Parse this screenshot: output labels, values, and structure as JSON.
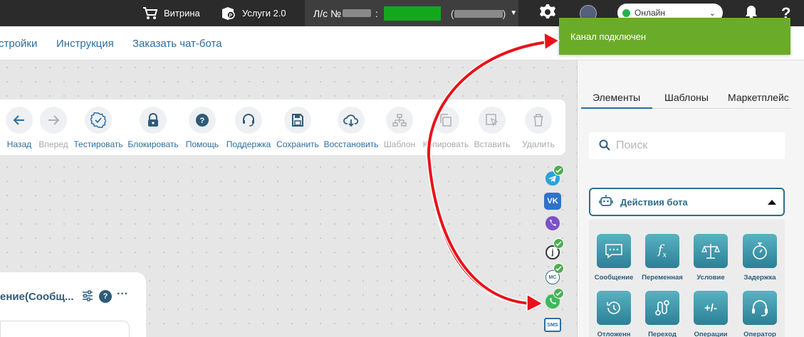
{
  "topbar": {
    "storefront_label": "Витрина",
    "services_label": "Услуги 2.0",
    "account_prefix": "Л/с №",
    "account_colon": ":",
    "paren_open": "(",
    "paren_close": ")",
    "status_label": "Онлайн"
  },
  "subnav": {
    "settings_partial": "стройки",
    "instruction": "Инструкция",
    "order_bot": "Заказать чат-бота"
  },
  "toast": {
    "message": "Канал подключен"
  },
  "toolbar": {
    "back": "Назад",
    "forward": "Вперед",
    "test": "Тестировать",
    "lock": "Блокировать",
    "help": "Помощь",
    "support": "Поддержка",
    "save": "Сохранить",
    "restore": "Восстановить",
    "template": "Шаблон",
    "copy": "Копировать",
    "paste": "Вставить",
    "delete": "Удалить"
  },
  "channels": {
    "sms": "SMS",
    "mc": "MC",
    "j": "j"
  },
  "node": {
    "title": "ение(Сообщ...",
    "help": "?",
    "more": "···"
  },
  "panel": {
    "tabs": [
      "Элементы",
      "Шаблоны",
      "Маркетплейс"
    ],
    "search_placeholder": "Поиск",
    "section_title": "Действия бота",
    "elements": [
      "Сообщение",
      "Переменная",
      "Условие",
      "Задержка",
      "Отложенн",
      "Переход",
      "Операции",
      "Оператор"
    ]
  },
  "colors": {
    "topbar": "#2b2b2b",
    "accent": "#2a6ea3",
    "toast": "#6bab2a",
    "online_dot": "#22b24c",
    "arrow": "#e8131a"
  }
}
